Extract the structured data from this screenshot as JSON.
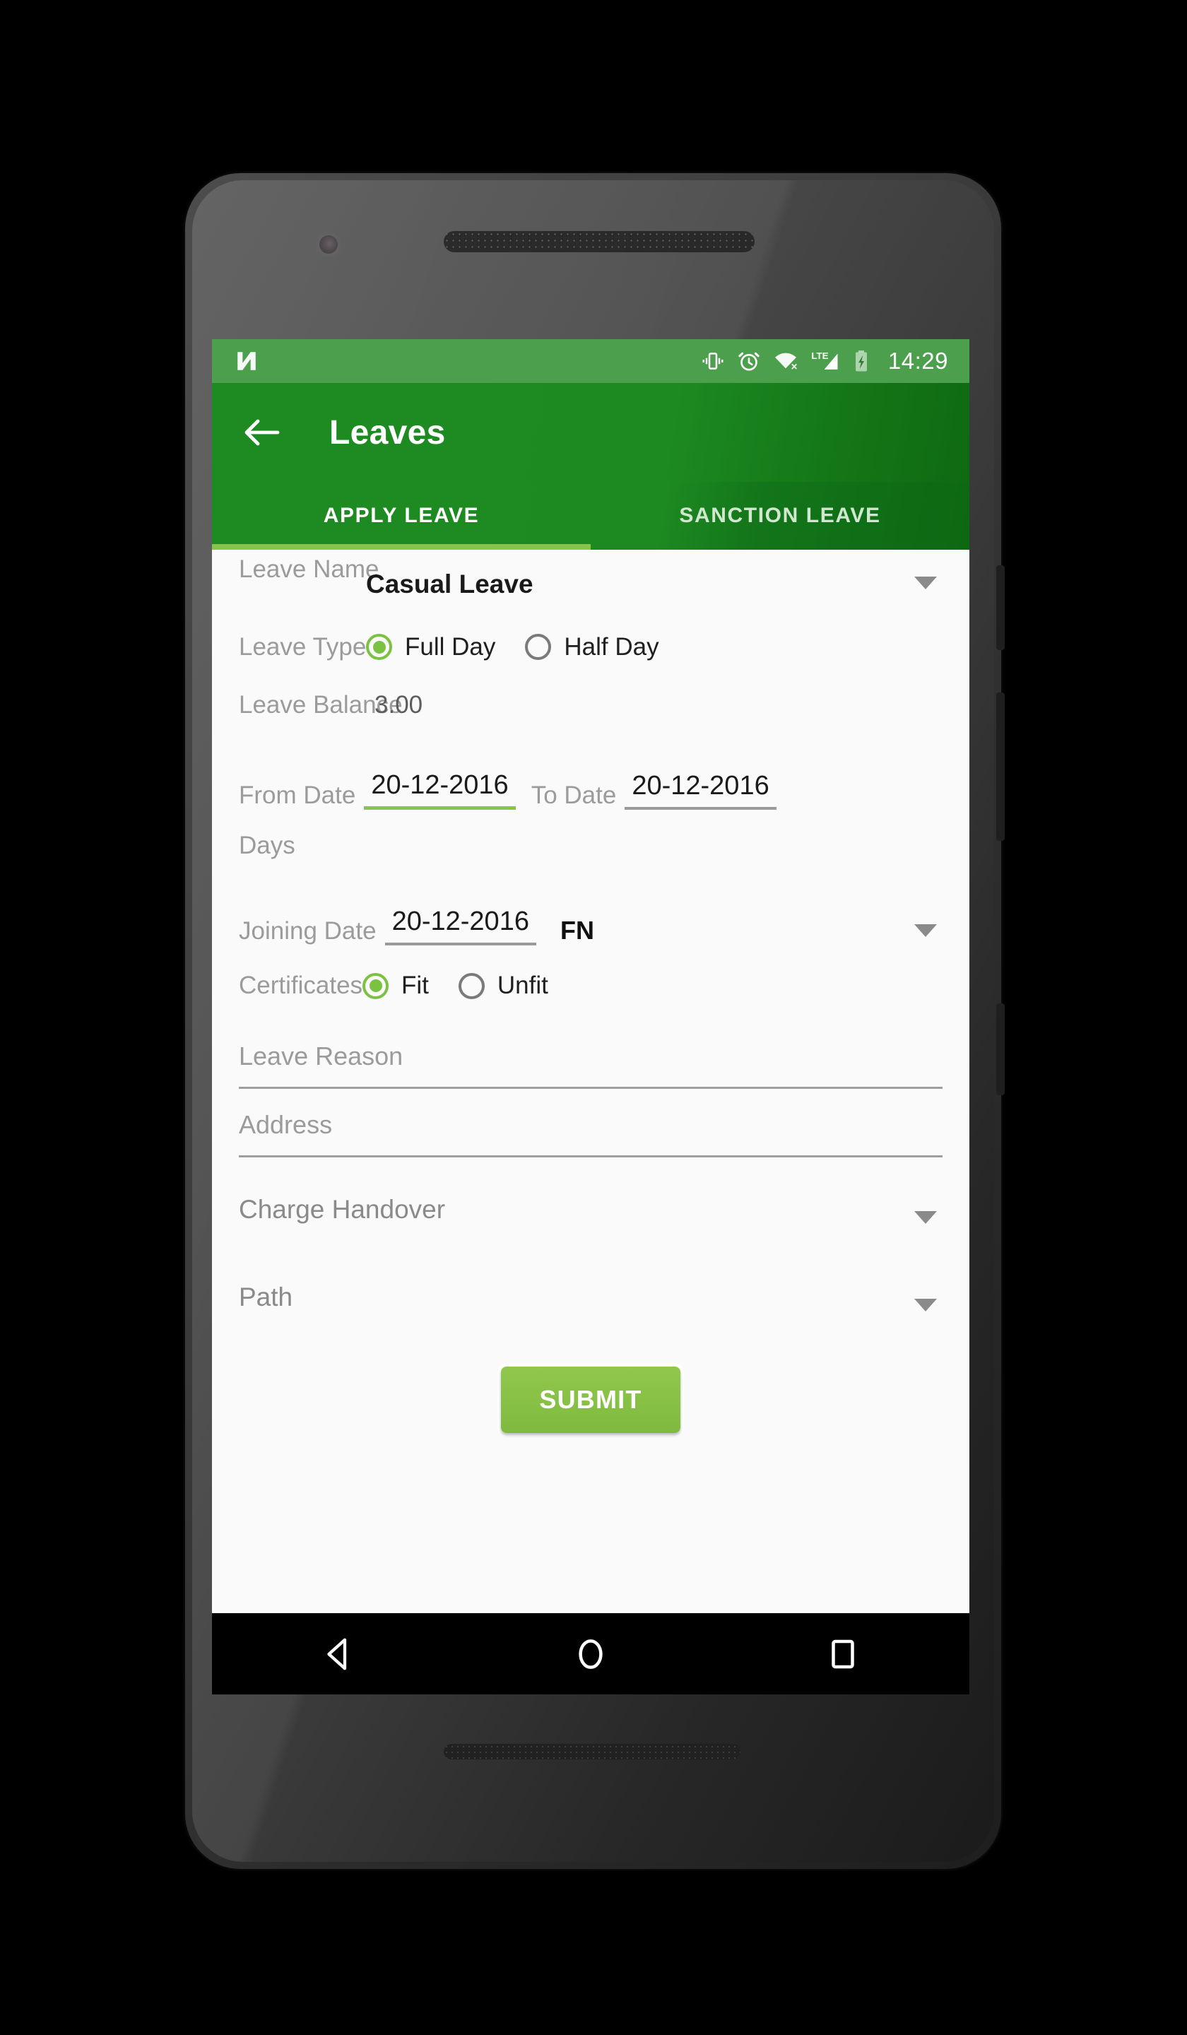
{
  "statusbar": {
    "logo_icon": "android-n-logo",
    "icons": [
      "vibrate-icon",
      "alarm-icon",
      "wifi-off-icon",
      "lte-signal-icon",
      "battery-charging-icon"
    ],
    "network_label": "LTE",
    "time": "14:29"
  },
  "appbar": {
    "back_icon": "back-arrow-icon",
    "title": "Leaves"
  },
  "tabs": [
    {
      "label": "APPLY LEAVE",
      "active": true
    },
    {
      "label": "SANCTION LEAVE",
      "active": false
    }
  ],
  "form": {
    "leave_name": {
      "label": "Leave Name",
      "value": "Casual Leave",
      "dropdown_icon": "chevron-down-icon"
    },
    "leave_type": {
      "label": "Leave Type",
      "options": [
        {
          "label": "Full Day",
          "selected": true
        },
        {
          "label": "Half Day",
          "selected": false
        }
      ]
    },
    "leave_balance": {
      "label": "Leave Balance",
      "value": "3.00"
    },
    "from_date": {
      "label": "From Date",
      "value": "20-12-2016"
    },
    "to_date": {
      "label": "To Date",
      "value": "20-12-2016"
    },
    "days": {
      "label": "Days",
      "value": ""
    },
    "joining_date": {
      "label": "Joining Date",
      "value": "20-12-2016",
      "session": "FN",
      "dropdown_icon": "chevron-down-icon"
    },
    "certificates": {
      "label": "Certificates",
      "options": [
        {
          "label": "Fit",
          "selected": true
        },
        {
          "label": "Unfit",
          "selected": false
        }
      ]
    },
    "leave_reason": {
      "placeholder": "Leave Reason",
      "value": ""
    },
    "address": {
      "placeholder": "Address",
      "value": ""
    },
    "charge_handover": {
      "label": "Charge Handover",
      "dropdown_icon": "chevron-down-icon"
    },
    "path": {
      "label": "Path",
      "dropdown_icon": "chevron-down-icon"
    },
    "submit": {
      "label": "SUBMIT"
    }
  },
  "navbar": {
    "back": "nav-back-icon",
    "home": "nav-home-icon",
    "recents": "nav-recents-icon"
  },
  "colors": {
    "status_bar": "#4C9F4C",
    "app_bar": "#1E8A22",
    "accent": "#8BC34A",
    "submit": "#86C044",
    "screen_bg": "#FAFAFA"
  }
}
